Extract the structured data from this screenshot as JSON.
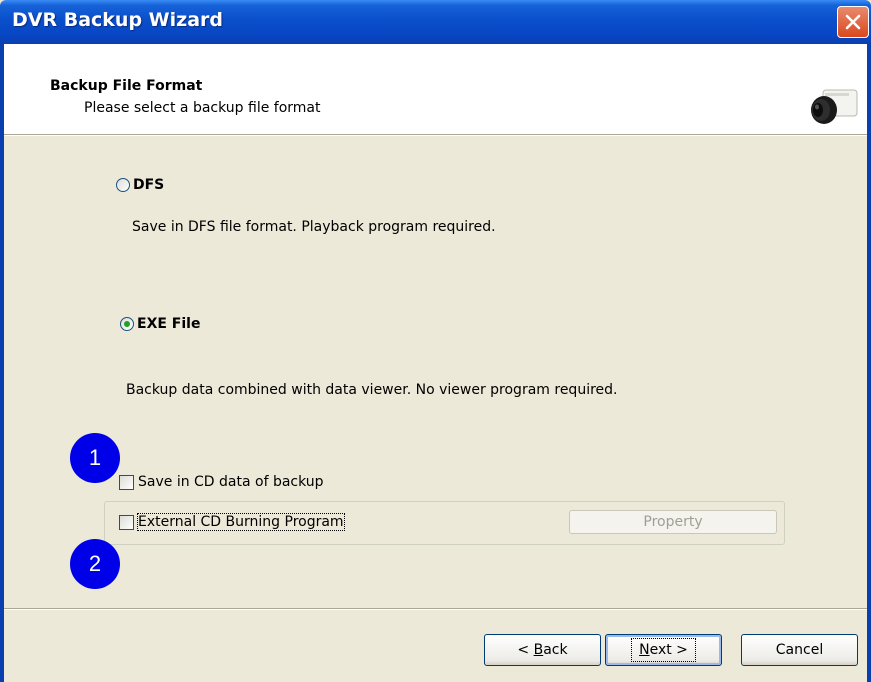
{
  "window": {
    "title": "DVR Backup Wizard",
    "close_icon": "close-icon"
  },
  "header": {
    "title": "Backup File Format",
    "subtitle": "Please select a backup file format",
    "icon": "camera-icon"
  },
  "options": {
    "dfs": {
      "label": "DFS",
      "selected": false,
      "description": "Save in DFS file format. Playback program required."
    },
    "exe": {
      "label": "EXE File",
      "selected": true,
      "description": "Backup data combined with data viewer. No viewer program required."
    }
  },
  "checkboxes": {
    "save_cd": {
      "label": "Save in CD data of backup",
      "checked": false
    },
    "external_cd": {
      "label": "External CD Burning Program",
      "checked": false
    }
  },
  "property_button": {
    "label": "Property",
    "enabled": false
  },
  "badges": [
    "1",
    "2"
  ],
  "buttons": {
    "back": {
      "prefix": "< ",
      "accel": "B",
      "rest": "ack"
    },
    "next": {
      "accel": "N",
      "rest": "ext >"
    },
    "cancel": {
      "label": "Cancel"
    }
  },
  "colors": {
    "titlebar": "#0A4FCB",
    "badge": "#0000E8",
    "radio_dot": "#21A121"
  }
}
